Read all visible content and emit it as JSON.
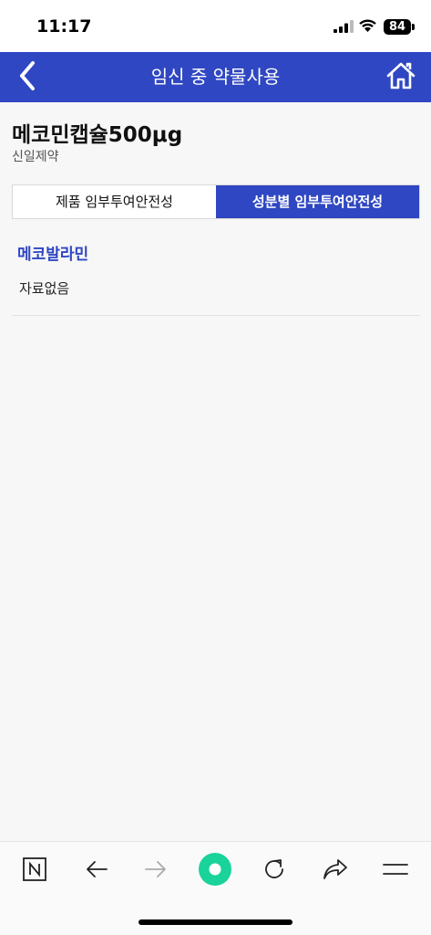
{
  "status_bar": {
    "time": "11:17",
    "battery": "84"
  },
  "header": {
    "title": "임신 중 약물사용",
    "back_icon": "chevron-left-icon",
    "home_icon": "home-icon",
    "color": "#2f47c2"
  },
  "product": {
    "name": "메코민캡슐500μg",
    "manufacturer": "신일제약"
  },
  "tabs": [
    {
      "label": "제품 임부투여안전성",
      "active": false
    },
    {
      "label": "성분별 임부투여안전성",
      "active": true
    }
  ],
  "content": {
    "ingredient": "메코발라민",
    "status_text": "자료없음"
  },
  "toolbar": {
    "items": [
      "naver-icon",
      "back-arrow-icon",
      "forward-arrow-icon",
      "green-circle-icon",
      "reload-icon",
      "share-icon",
      "menu-icon"
    ],
    "accent": "#19d39a"
  }
}
